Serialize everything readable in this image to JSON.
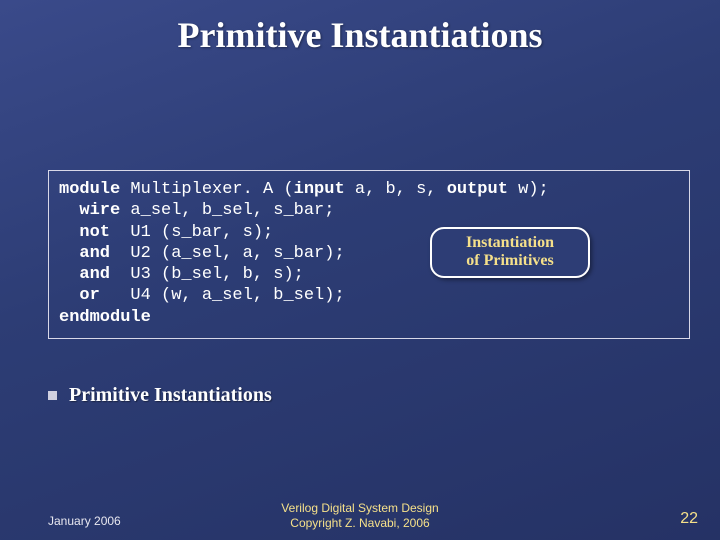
{
  "title": "Primitive Instantiations",
  "code": {
    "l1": {
      "kw1": "module",
      "rest1": " Multiplexer. A (",
      "kw2": "input",
      "rest2": " a, b, s, ",
      "kw3": "output",
      "rest3": " w);"
    },
    "l2": {
      "kw": "wire",
      "rest": " a_sel, b_sel, s_bar;"
    },
    "l3": {
      "kw": "not",
      "rest": "  U1 (s_bar, s);"
    },
    "l4": {
      "kw": "and",
      "rest": "  U2 (a_sel, a, s_bar);"
    },
    "l5": {
      "kw": "and",
      "rest": "  U3 (b_sel, b, s);"
    },
    "l6": {
      "kw": "or",
      "rest": "   U4 (w, a_sel, b_sel);"
    },
    "l7": {
      "kw": "endmodule"
    }
  },
  "callout": {
    "line1": "Instantiation",
    "line2": "of Primitives"
  },
  "bullet": "Primitive Instantiations",
  "footer": {
    "left": "January 2006",
    "center1": "Verilog Digital System Design",
    "center2": "Copyright Z. Navabi, 2006",
    "right": "22"
  }
}
